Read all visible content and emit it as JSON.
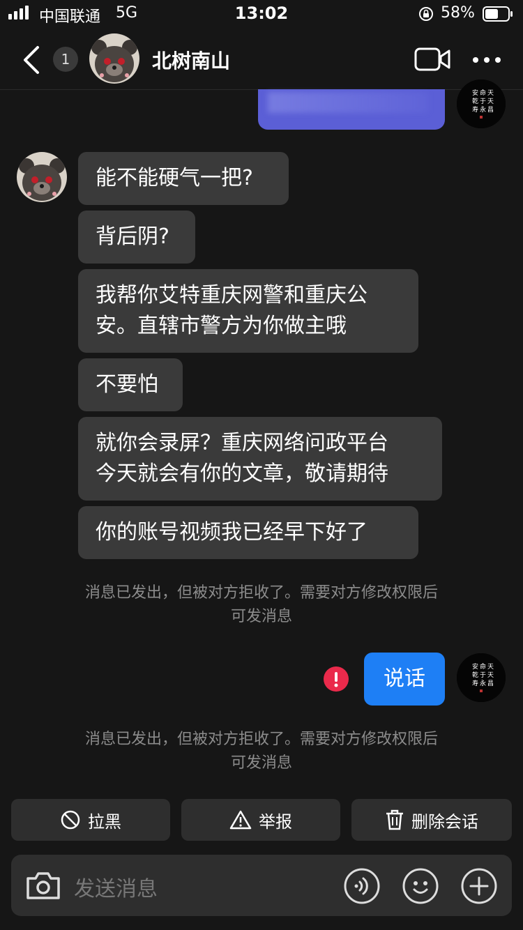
{
  "status_bar": {
    "carrier": "中国联通",
    "network": "5G",
    "time": "13:02",
    "battery_percent": "58%",
    "battery_level": 0.58
  },
  "header": {
    "unread_count": "1",
    "contact_name": "北树南山"
  },
  "messages": {
    "received": [
      "能不能硬气一把?",
      "背后阴?",
      "我帮你艾特重庆网警和重庆公\n安。直辖市警方为你做主哦",
      "不要怕",
      "就你会录屏？重庆网络问政平台\n今天就会有你的文章，敬请期待",
      "你的账号视频我已经早下好了"
    ],
    "sent": [
      "说话"
    ],
    "notice_line1": "消息已发出，但被对方拒收了。需要对方修改权限后",
    "notice_line2": "可发消息"
  },
  "actions": {
    "block": "拉黑",
    "report": "举报",
    "delete": "删除会话"
  },
  "input": {
    "placeholder": "发送消息"
  },
  "colors": {
    "background": "#161616",
    "bubble_received": "#3a3a3a",
    "bubble_sent": "#1e7ff5",
    "error": "#ea2a4b",
    "blurred_bubble": "#5b5fd6"
  }
}
